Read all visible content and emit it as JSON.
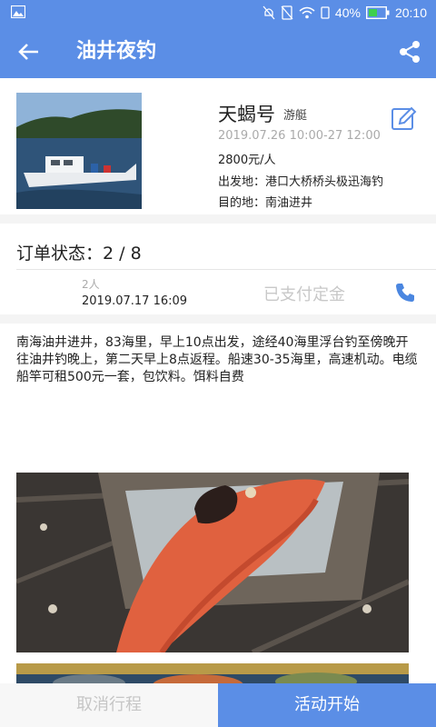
{
  "status_bar": {
    "battery": "40%",
    "time": "20:10",
    "icons": [
      "image-icon",
      "mute-icon",
      "no-sim-icon",
      "wifi-icon",
      "sim-icon",
      "battery-icon"
    ]
  },
  "app_bar": {
    "title": "油井夜钓",
    "back_icon": "arrow-left-icon",
    "share_icon": "share-icon"
  },
  "boat": {
    "name": "天蝎号",
    "type": "游艇",
    "date": "2019.07.26 10:00-27 12:00",
    "price": "2800元/人",
    "departure": "出发地：港口大桥桥头极迅海钓",
    "destination": "目的地：南油进井"
  },
  "order": {
    "status": "订单状态：2 / 8",
    "persons": "2人",
    "time": "2019.07.17 16:09",
    "payment_status": "已支付定金"
  },
  "description": "南海油井进井，83海里，早上10点出发，途经40海里浮台钓至傍晚开往油井钓晚上，第二天早上8点返程。船速30-35海里，高速机动。电缆船竿可租500元一套，包饮料。饵料自费",
  "actions": {
    "cancel": "取消行程",
    "start": "活动开始"
  },
  "colors": {
    "primary": "#5b8ee6",
    "muted": "#c6c6c6"
  }
}
